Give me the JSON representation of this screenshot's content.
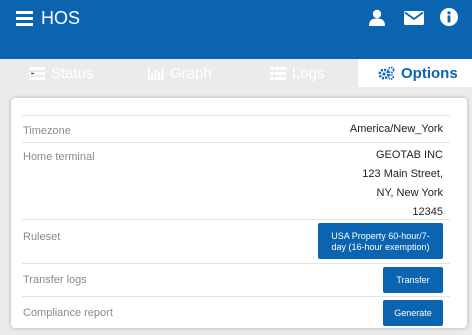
{
  "header": {
    "title": "HOS",
    "icons": [
      "menu-icon",
      "user-icon",
      "mail-icon",
      "info-icon"
    ]
  },
  "tabs": [
    {
      "label": "Status",
      "icon": "status-icon"
    },
    {
      "label": "Graph",
      "icon": "bar-chart-icon"
    },
    {
      "label": "Logs",
      "icon": "list-icon"
    },
    {
      "label": "Options",
      "icon": "gears-icon",
      "active": true
    }
  ],
  "options": {
    "timezone": {
      "label": "Timezone",
      "value": "America/New_York"
    },
    "home_terminal": {
      "label": "Home terminal",
      "lines": [
        "GEOTAB INC",
        "123 Main Street,",
        "NY, New York",
        "12345"
      ]
    },
    "ruleset": {
      "label": "Ruleset",
      "button_line1": "USA Property 60-hour/7-",
      "button_line2": "day (16-hour exemption)"
    },
    "transfer_logs": {
      "label": "Transfer logs",
      "button": "Transfer"
    },
    "compliance_report": {
      "label": "Compliance report",
      "button": "Generate"
    }
  },
  "colors": {
    "primary": "#0b64b0",
    "background": "#ebebeb"
  }
}
